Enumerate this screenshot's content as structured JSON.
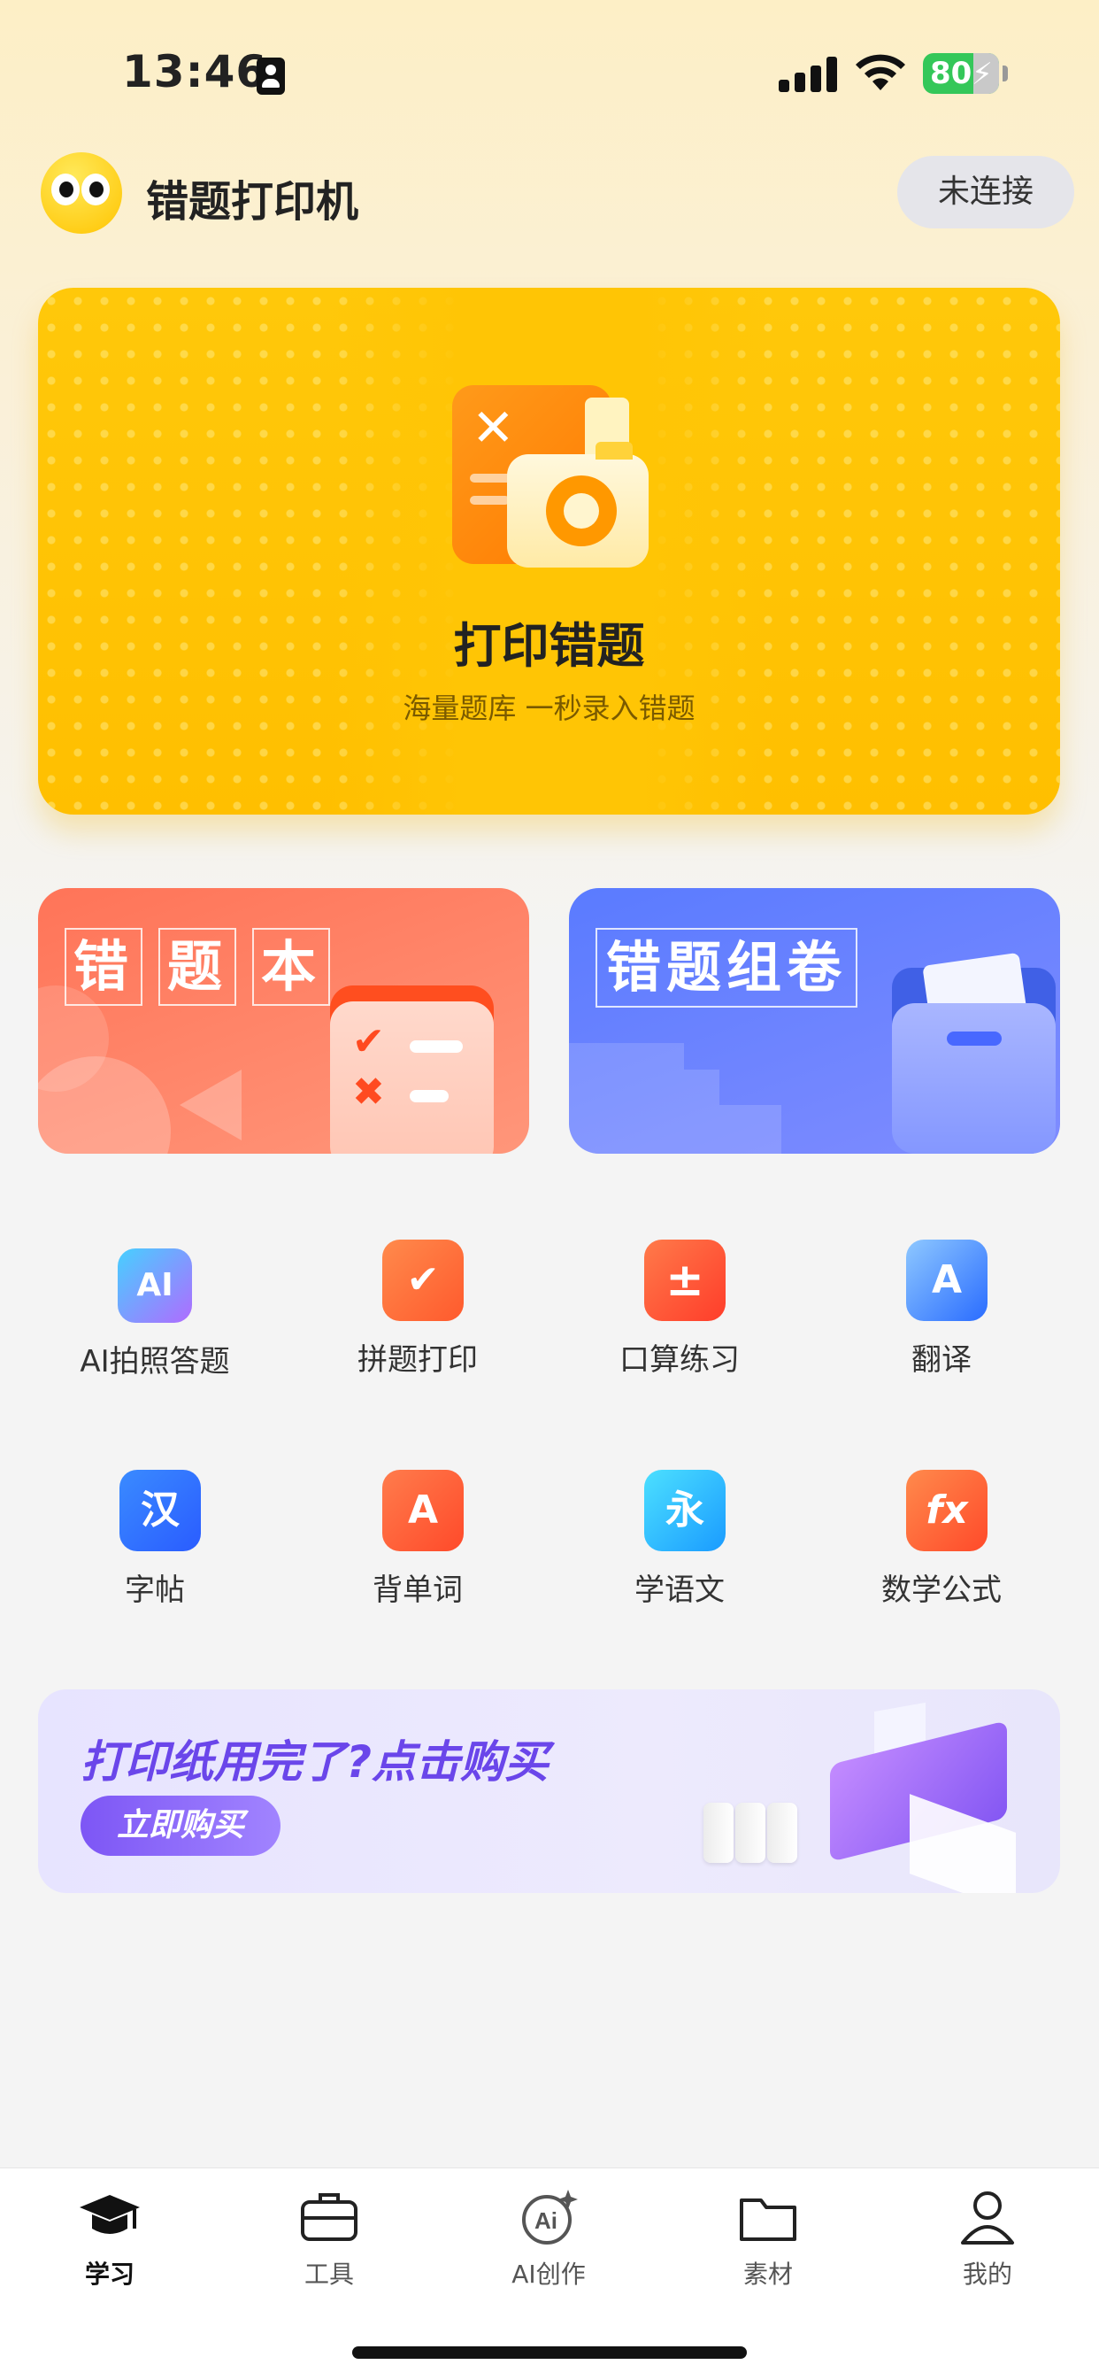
{
  "status_bar": {
    "time": "13:46",
    "battery": "80"
  },
  "header": {
    "app_title": "错题打印机",
    "connect_button": "未连接"
  },
  "hero": {
    "title": "打印错题",
    "subtitle": "海量题库 一秒录入错题"
  },
  "cards": {
    "mistake_book": [
      "错",
      "题",
      "本"
    ],
    "compose_paper": "错题组卷"
  },
  "features": [
    {
      "label": "AI拍照答题",
      "icon": "ai-camera-icon",
      "glyph": "AI"
    },
    {
      "label": "拼题打印",
      "icon": "checklist-book-icon",
      "glyph": "✔"
    },
    {
      "label": "口算练习",
      "icon": "calculator-icon",
      "glyph": "±"
    },
    {
      "label": "翻译",
      "icon": "translate-icon",
      "glyph": "A"
    },
    {
      "label": "字帖",
      "icon": "hanzi-icon",
      "glyph": "汉"
    },
    {
      "label": "背单词",
      "icon": "vocabulary-icon",
      "glyph": "A"
    },
    {
      "label": "学语文",
      "icon": "chinese-book-icon",
      "glyph": "永"
    },
    {
      "label": "数学公式",
      "icon": "formula-icon",
      "glyph": "fx"
    }
  ],
  "banner": {
    "title": "打印纸用完了?点击购买",
    "button": "立即购买"
  },
  "tabbar": [
    {
      "label": "学习",
      "icon": "graduation-cap-icon",
      "active": true
    },
    {
      "label": "工具",
      "icon": "toolbox-icon",
      "active": false
    },
    {
      "label": "AI创作",
      "icon": "ai-create-icon",
      "active": false
    },
    {
      "label": "素材",
      "icon": "folder-icon",
      "active": false
    },
    {
      "label": "我的",
      "icon": "profile-icon",
      "active": false
    }
  ],
  "colors": {
    "accent": "#ffc400",
    "red_card": "#ff7458",
    "blue_card": "#5a7bff",
    "banner_purple": "#6a46ea"
  }
}
